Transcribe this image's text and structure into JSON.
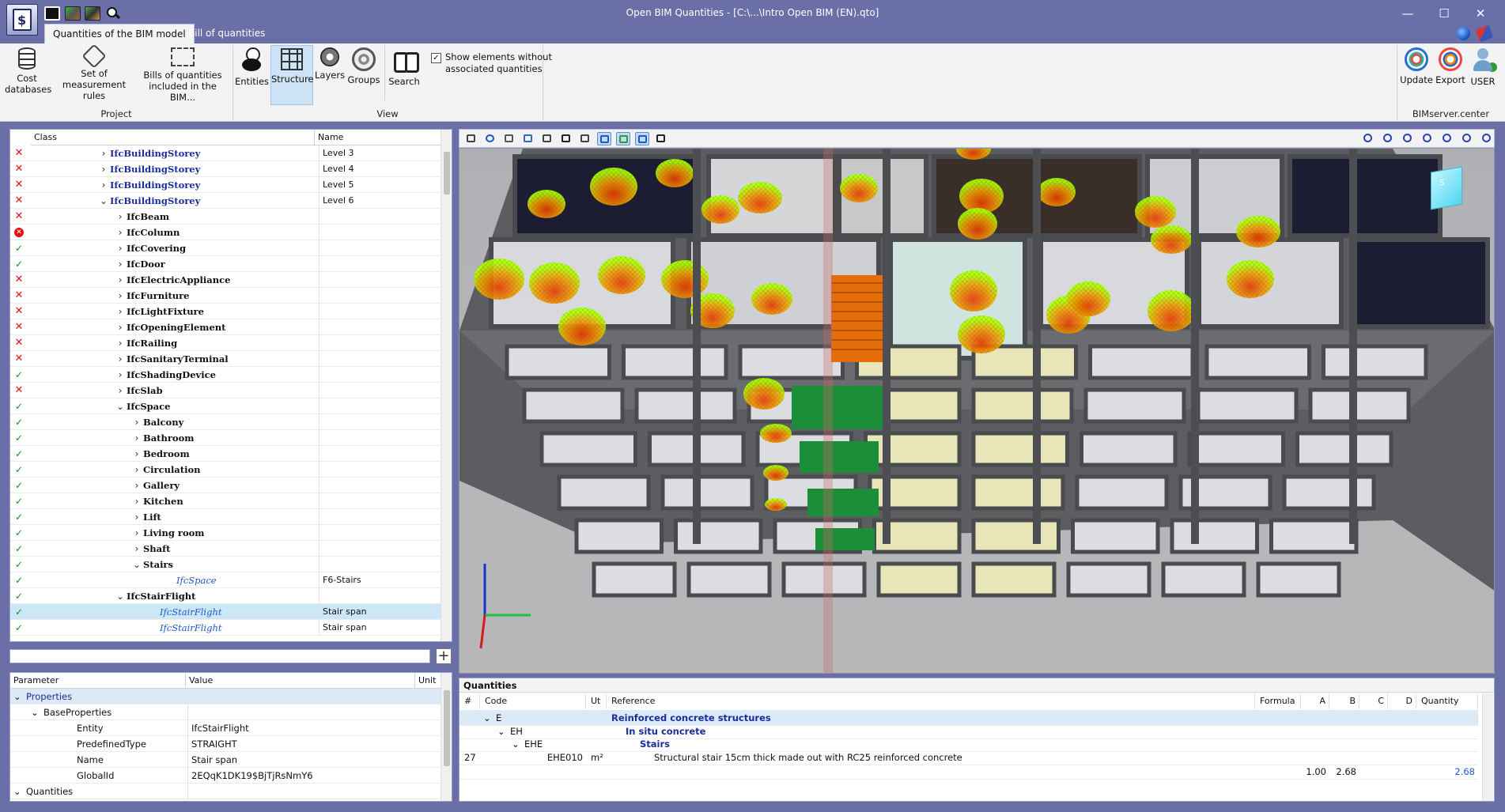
{
  "window": {
    "title": "Open BIM Quantities - [C:\\...\\Intro Open BIM (EN).qto]",
    "controls": {
      "minimize": "—",
      "maximize": "☐",
      "close": "✕"
    }
  },
  "tabs": [
    {
      "label": "Quantities of the BIM model",
      "active": true
    },
    {
      "label": "Bill of quantities",
      "active": false
    }
  ],
  "ribbon": {
    "groups": {
      "project": "Project",
      "view": "View",
      "bimserver": "BIMserver.center"
    },
    "project": [
      {
        "label": "Cost databases",
        "icon": "database-icon"
      },
      {
        "label": "Set of measurement rules",
        "icon": "tools-icon"
      },
      {
        "label": "Bills of quantities included in the BIM...",
        "icon": "bim-bills-icon"
      }
    ],
    "view": [
      {
        "label": "Entities",
        "icon": "entities-icon"
      },
      {
        "label": "Structure",
        "icon": "structure-icon",
        "selected": true
      },
      {
        "label": "Layers",
        "icon": "layers-icon"
      },
      {
        "label": "Groups",
        "icon": "groups-icon"
      },
      {
        "label": "Search",
        "icon": "binoculars-icon"
      }
    ],
    "show_elements_checkbox": {
      "label": "Show elements without associated quantities",
      "checked": true,
      "mark": "✓"
    },
    "bimserver": [
      {
        "label": "Update",
        "icon": "update-icon"
      },
      {
        "label": "Export",
        "icon": "export-icon"
      },
      {
        "label": "USER",
        "icon": "user-icon"
      }
    ]
  },
  "tree": {
    "columns": {
      "class": "Class",
      "name": "Name"
    },
    "rows": [
      {
        "status": "x",
        "level": 0,
        "expander": "›",
        "class": "IfcBuildingStorey",
        "style": "bold",
        "name": "Level 3"
      },
      {
        "status": "x",
        "level": 0,
        "expander": "›",
        "class": "IfcBuildingStorey",
        "style": "bold",
        "name": "Level 4"
      },
      {
        "status": "x",
        "level": 0,
        "expander": "›",
        "class": "IfcBuildingStorey",
        "style": "bold",
        "name": "Level 5"
      },
      {
        "status": "x",
        "level": 0,
        "expander": "⌄",
        "class": "IfcBuildingStorey",
        "style": "bold",
        "name": "Level 6"
      },
      {
        "status": "x",
        "level": 1,
        "expander": "›",
        "class": "IfcBeam",
        "style": "normal",
        "name": ""
      },
      {
        "status": "err",
        "level": 1,
        "expander": "›",
        "class": "IfcColumn",
        "style": "normal",
        "name": ""
      },
      {
        "status": "ok",
        "level": 1,
        "expander": "›",
        "class": "IfcCovering",
        "style": "normal",
        "name": ""
      },
      {
        "status": "ok",
        "level": 1,
        "expander": "›",
        "class": "IfcDoor",
        "style": "normal",
        "name": ""
      },
      {
        "status": "x",
        "level": 1,
        "expander": "›",
        "class": "IfcElectricAppliance",
        "style": "normal",
        "name": ""
      },
      {
        "status": "x",
        "level": 1,
        "expander": "›",
        "class": "IfcFurniture",
        "style": "normal",
        "name": ""
      },
      {
        "status": "x",
        "level": 1,
        "expander": "›",
        "class": "IfcLightFixture",
        "style": "normal",
        "name": ""
      },
      {
        "status": "x",
        "level": 1,
        "expander": "›",
        "class": "IfcOpeningElement",
        "style": "normal",
        "name": ""
      },
      {
        "status": "x",
        "level": 1,
        "expander": "›",
        "class": "IfcRailing",
        "style": "normal",
        "name": ""
      },
      {
        "status": "x",
        "level": 1,
        "expander": "›",
        "class": "IfcSanitaryTerminal",
        "style": "normal",
        "name": ""
      },
      {
        "status": "ok",
        "level": 1,
        "expander": "›",
        "class": "IfcShadingDevice",
        "style": "normal",
        "name": ""
      },
      {
        "status": "x",
        "level": 1,
        "expander": "›",
        "class": "IfcSlab",
        "style": "normal",
        "name": ""
      },
      {
        "status": "ok",
        "level": 1,
        "expander": "⌄",
        "class": "IfcSpace",
        "style": "normal",
        "name": ""
      },
      {
        "status": "ok",
        "level": 2,
        "expander": "›",
        "class": "Balcony",
        "style": "normal",
        "name": ""
      },
      {
        "status": "ok",
        "level": 2,
        "expander": "›",
        "class": "Bathroom",
        "style": "normal",
        "name": ""
      },
      {
        "status": "ok",
        "level": 2,
        "expander": "›",
        "class": "Bedroom",
        "style": "normal",
        "name": ""
      },
      {
        "status": "ok",
        "level": 2,
        "expander": "›",
        "class": "Circulation",
        "style": "normal",
        "name": ""
      },
      {
        "status": "ok",
        "level": 2,
        "expander": "›",
        "class": "Gallery",
        "style": "normal",
        "name": ""
      },
      {
        "status": "ok",
        "level": 2,
        "expander": "›",
        "class": "Kitchen",
        "style": "normal",
        "name": ""
      },
      {
        "status": "ok",
        "level": 2,
        "expander": "›",
        "class": "Lift",
        "style": "normal",
        "name": ""
      },
      {
        "status": "ok",
        "level": 2,
        "expander": "›",
        "class": "Living room",
        "style": "normal",
        "name": ""
      },
      {
        "status": "ok",
        "level": 2,
        "expander": "›",
        "class": "Shaft",
        "style": "normal",
        "name": ""
      },
      {
        "status": "ok",
        "level": 2,
        "expander": "⌄",
        "class": "Stairs",
        "style": "normal",
        "name": ""
      },
      {
        "status": "ok",
        "level": 4,
        "expander": "",
        "class": "IfcSpace",
        "style": "italic",
        "name": "F6-Stairs"
      },
      {
        "status": "ok",
        "level": 1,
        "expander": "⌄",
        "class": "IfcStairFlight",
        "style": "normal",
        "name": ""
      },
      {
        "status": "ok",
        "level": 3,
        "expander": "",
        "class": "IfcStairFlight",
        "style": "italic",
        "name": "Stair span",
        "selected": true
      },
      {
        "status": "ok",
        "level": 3,
        "expander": "",
        "class": "IfcStairFlight",
        "style": "italic",
        "name": "Stair span"
      }
    ]
  },
  "filter": {
    "placeholder": "",
    "add_label": "+"
  },
  "properties": {
    "columns": {
      "parameter": "Parameter",
      "value": "Value",
      "unit": "Unit"
    },
    "rows": [
      {
        "level": 0,
        "expander": "⌄",
        "key": "Properties",
        "value": "",
        "section": true
      },
      {
        "level": 1,
        "expander": "⌄",
        "key": "BaseProperties",
        "value": ""
      },
      {
        "level": 2,
        "expander": "",
        "key": "Entity",
        "value": "IfcStairFlight"
      },
      {
        "level": 2,
        "expander": "",
        "key": "PredefinedType",
        "value": "STRAIGHT"
      },
      {
        "level": 2,
        "expander": "",
        "key": "Name",
        "value": "Stair span"
      },
      {
        "level": 2,
        "expander": "",
        "key": "GlobalId",
        "value": "2EQqK1DK19$BjTjRsNmY6"
      },
      {
        "level": 0,
        "expander": "⌄",
        "key": "Quantities",
        "value": ""
      }
    ]
  },
  "viewport": {
    "toolbar_left": [
      "layers-icon",
      "info-icon",
      "axes-icon",
      "cube-icon",
      "cubes-icon",
      "eye-shade-icon",
      "rotate-icon",
      "section-icon",
      "pen-icon",
      "plan-icon",
      "view-eye-icon"
    ],
    "toolbar_right": [
      "zoom-extents-icon",
      "zoom-window-icon",
      "zoom-prev-icon",
      "rotate-view-icon",
      "zoom-icon",
      "pan-icon",
      "fullscreen-icon"
    ],
    "navcube_label": "S"
  },
  "quantities": {
    "title": "Quantities",
    "columns": {
      "num": "#",
      "code": "Code",
      "ut": "Ut",
      "reference": "Reference",
      "formula": "Formula",
      "a": "A",
      "b": "B",
      "c": "C",
      "d": "D",
      "quantity": "Quantity"
    },
    "rows": [
      {
        "num": "",
        "expander": "⌄",
        "code": "E",
        "ut": "",
        "reference": "Reinforced concrete structures",
        "indent": 0,
        "bold": true,
        "hl": true
      },
      {
        "num": "",
        "expander": "⌄",
        "code": "EH",
        "ut": "",
        "reference": "In situ concrete",
        "indent": 1,
        "bold": true
      },
      {
        "num": "",
        "expander": "⌄",
        "code": "EHE",
        "ut": "",
        "reference": "Stairs",
        "indent": 2,
        "bold": true
      },
      {
        "num": "27",
        "expander": "",
        "code": "EHE010",
        "ut": "m²",
        "reference": "Structural stair 15cm thick made out with RC25 reinforced concrete",
        "indent": 3,
        "bold": false
      }
    ],
    "totals": {
      "a": "1.00",
      "b": "2.68",
      "quantity": "2.68"
    }
  },
  "colors": {
    "accent": "#6b6fa8",
    "selection": "#cce8f6",
    "ok": "#1a8a1a",
    "error": "#dd1111",
    "link": "#1f56c8"
  }
}
